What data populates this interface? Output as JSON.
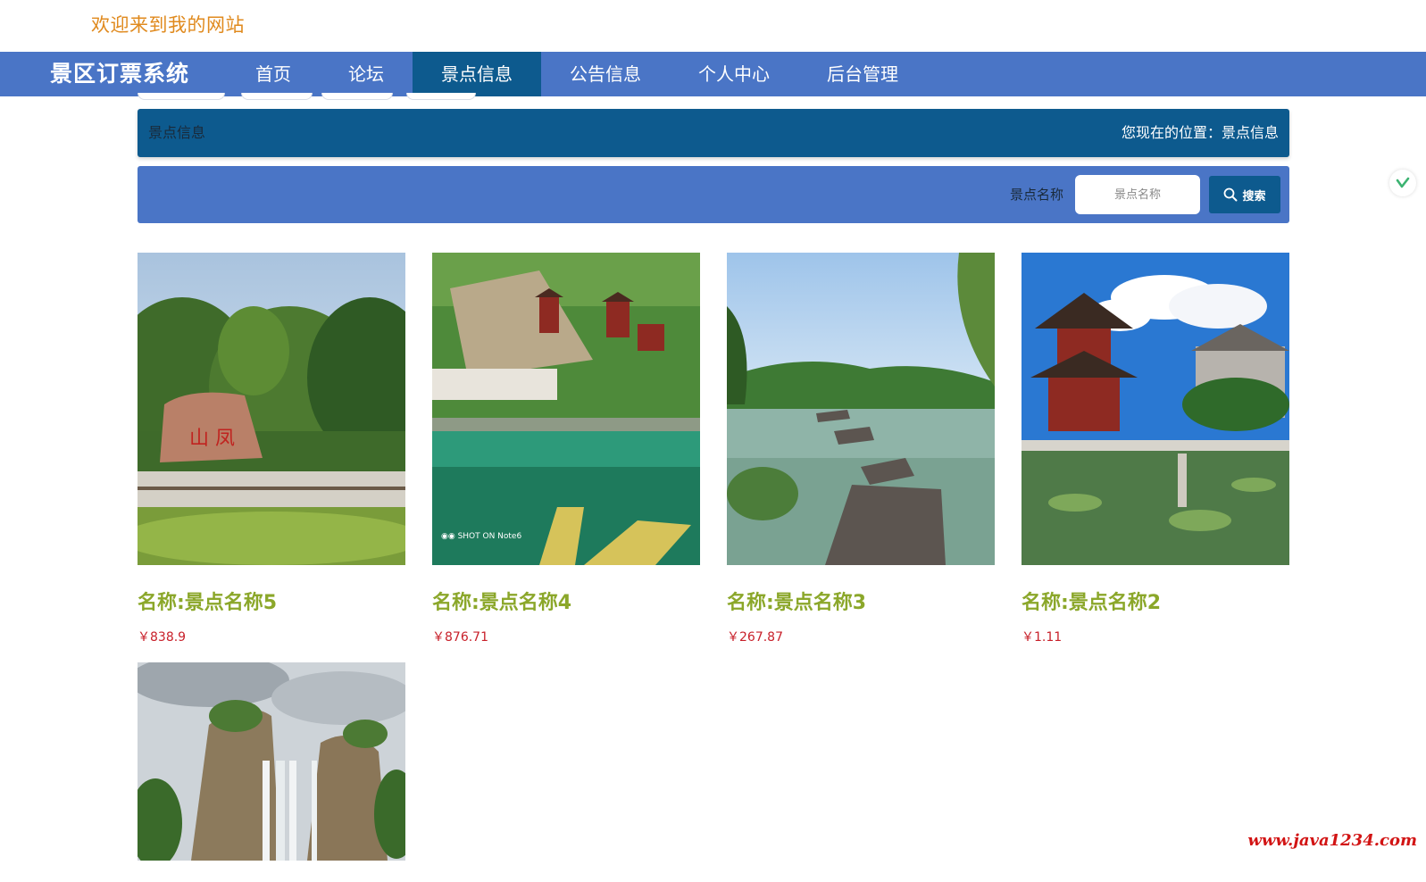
{
  "header": {
    "welcome": "欢迎来到我的网站"
  },
  "navbar": {
    "brand": "景区订票系统",
    "items": [
      {
        "label": "首页",
        "active": false
      },
      {
        "label": "论坛",
        "active": false
      },
      {
        "label": "景点信息",
        "active": true
      },
      {
        "label": "公告信息",
        "active": false
      },
      {
        "label": "个人中心",
        "active": false
      },
      {
        "label": "后台管理",
        "active": false
      }
    ]
  },
  "titlebar": {
    "title": "景点信息",
    "location_label": "您现在的位置：",
    "location_value": "景点信息"
  },
  "search": {
    "label": "景点名称",
    "placeholder": "景点名称",
    "button_label": "搜索"
  },
  "spots": [
    {
      "name": "名称:景点名称5",
      "price": "￥838.9"
    },
    {
      "name": "名称:景点名称4",
      "price": "￥876.71"
    },
    {
      "name": "名称:景点名称3",
      "price": "￥267.87"
    },
    {
      "name": "名称:景点名称2",
      "price": "￥1.11"
    },
    {
      "name": "",
      "price": ""
    }
  ],
  "watermark": "www.java1234.com",
  "colors": {
    "nav_bg": "#4a75c6",
    "active_bg": "#0d5a8e",
    "welcome": "#e08a1e",
    "spot_name": "#8ba72a",
    "price": "#c8202a"
  }
}
